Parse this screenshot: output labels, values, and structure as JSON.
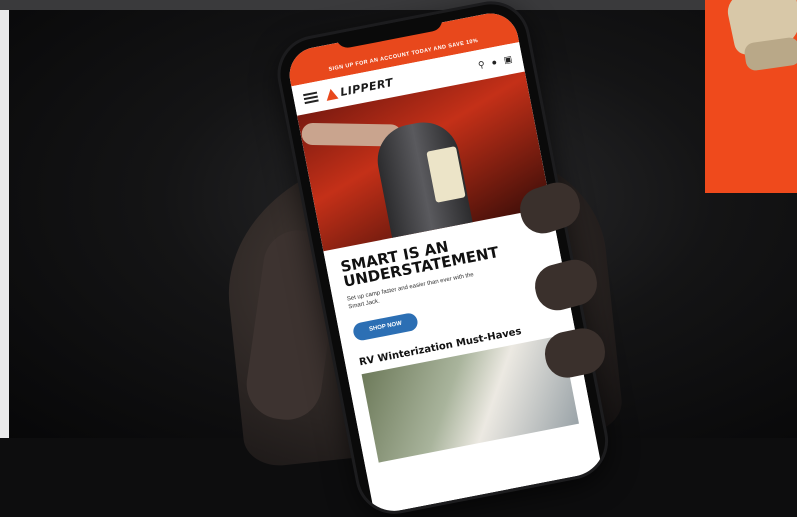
{
  "promo_bar": {
    "text": "SIGN UP FOR AN ACCOUNT TODAY AND SAVE 10%"
  },
  "brand": {
    "name": "LIPPERT",
    "accent": "#e8481c"
  },
  "nav_icons": [
    "menu-icon",
    "search-icon",
    "account-icon",
    "cart-icon"
  ],
  "hero": {
    "headline": "SMART IS AN UNDERSTATEMENT",
    "subtext": "Set up camp faster and easier than ever with the Smart Jack.",
    "cta": "SHOP NOW"
  },
  "section": {
    "title": "RV Winterization Must-Haves"
  },
  "colors": {
    "cta": "#2c6fb4",
    "inset_background": "#ef4a1c"
  }
}
